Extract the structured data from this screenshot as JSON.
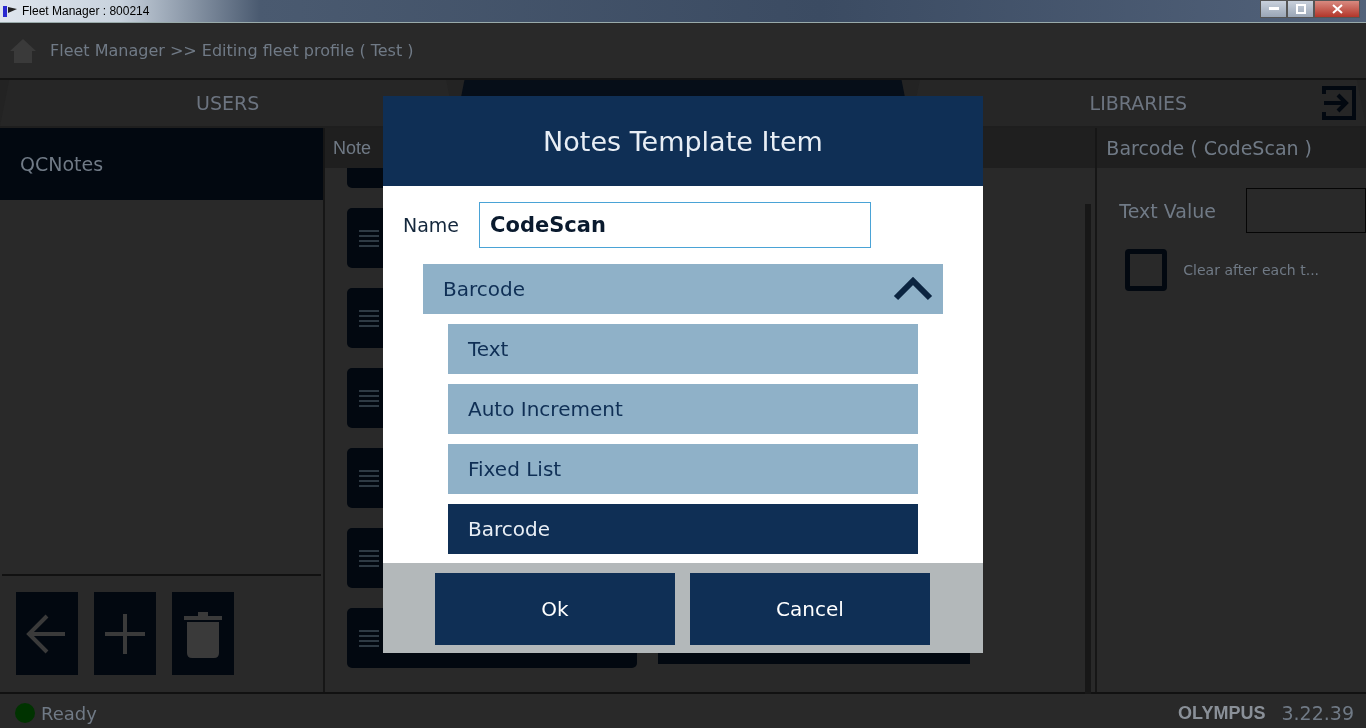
{
  "window": {
    "title": "Fleet Manager : 800214"
  },
  "breadcrumb": "Fleet Manager >> Editing fleet profile ( Test )",
  "tabs": [
    {
      "label": "USERS",
      "selected": false
    },
    {
      "selected": true
    },
    {
      "label": "LIBRARIES",
      "selected": false
    }
  ],
  "profiles": [
    {
      "label": "QCNotes",
      "selected": true
    }
  ],
  "items_panel": {
    "header": "Note"
  },
  "details": {
    "header": "Barcode ( CodeScan )",
    "field_label": "Text Value",
    "checkbox": {
      "label": "Clear after each t...",
      "checked": false
    }
  },
  "status_bar": {
    "status": "Ready",
    "brand": "OLYMPUS",
    "version": "3.22.39"
  },
  "dialog": {
    "title": "Notes Template Item",
    "name_label": "Name",
    "name_value": "CodeScan",
    "dropdown": {
      "value": "Barcode",
      "expanded": true,
      "options": [
        {
          "label": "Text",
          "selected": false
        },
        {
          "label": "Auto Increment",
          "selected": false
        },
        {
          "label": "Fixed List",
          "selected": false
        },
        {
          "label": "Barcode",
          "selected": true
        }
      ]
    },
    "buttons": [
      "Ok",
      "Cancel"
    ]
  }
}
